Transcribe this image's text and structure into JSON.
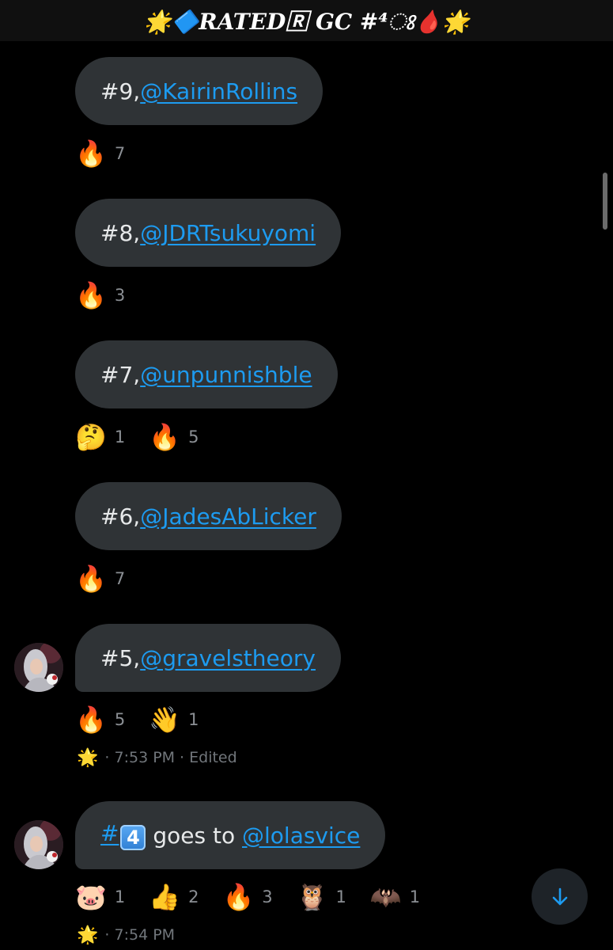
{
  "header": {
    "title": "🌟🔷RATED🅁 GC #⁴ଃ🩸🌟"
  },
  "messages": [
    {
      "rank": "#9, ",
      "mention": "@KairinRollins",
      "reactions": [
        {
          "emoji": "🔥",
          "count": "7"
        }
      ]
    },
    {
      "rank": "#8, ",
      "mention": "@JDRTsukuyomi",
      "reactions": [
        {
          "emoji": "🔥",
          "count": "3"
        }
      ]
    },
    {
      "rank": "#7, ",
      "mention": "@unpunnishble",
      "reactions": [
        {
          "emoji": "🤔",
          "count": "1"
        },
        {
          "emoji": "🔥",
          "count": "5"
        }
      ]
    },
    {
      "rank": "#6, ",
      "mention": "@JadesAbLicker",
      "reactions": [
        {
          "emoji": "🔥",
          "count": "7"
        }
      ]
    },
    {
      "rank": "#5, ",
      "mention": "@gravelstheory",
      "reactions": [
        {
          "emoji": "🔥",
          "count": "5"
        },
        {
          "emoji": "👋",
          "count": "1"
        }
      ],
      "meta": {
        "star": "🌟",
        "time": "· 7:53 PM",
        "edited": "· Edited"
      }
    },
    {
      "hash": "#",
      "keycap": "4",
      "text": " goes to ",
      "mention": "@lolasvice",
      "reactions": [
        {
          "emoji": "🐷",
          "count": "1"
        },
        {
          "emoji": "👍",
          "count": "2"
        },
        {
          "emoji": "🔥",
          "count": "3"
        },
        {
          "emoji": "🦉",
          "count": "1"
        },
        {
          "emoji": "🦇",
          "count": "1"
        }
      ],
      "meta": {
        "star": "🌟",
        "time": "· 7:54 PM"
      }
    }
  ],
  "icons": {
    "avatar": "user-avatar",
    "scroll_down": "arrow-down-icon"
  },
  "colors": {
    "link": "#1d9bf0",
    "bubble": "#2f3336",
    "background": "#000000"
  }
}
